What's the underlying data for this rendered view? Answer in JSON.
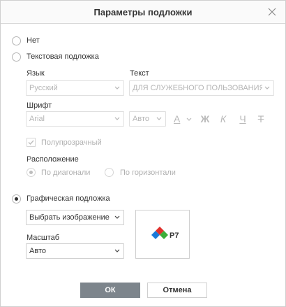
{
  "dialog": {
    "title": "Параметры подложки",
    "close_icon": "close-icon"
  },
  "options": {
    "none_label": "Нет",
    "text_watermark_label": "Текстовая подложка",
    "image_watermark_label": "Графическая подложка",
    "selected": "image"
  },
  "text_section": {
    "language_label": "Язык",
    "language_value": "Русский",
    "text_label": "Текст",
    "text_value": "ДЛЯ СЛУЖЕБНОГО ПОЛЬЗОВАНИЯ",
    "font_label": "Шрифт",
    "font_value": "Arial",
    "size_value": "Авто",
    "format_buttons": {
      "color": "A",
      "bold": "Ж",
      "italic": "К",
      "underline": "Ч",
      "strike": "Т"
    },
    "semitransparent_label": "Полупрозрачный",
    "semitransparent_checked": true,
    "layout_label": "Расположение",
    "layout_diagonal_label": "По диагонали",
    "layout_horizontal_label": "По горизонтали",
    "layout_selected": "diagonal"
  },
  "image_section": {
    "choose_image_label": "Выбрать изображение",
    "scale_label": "Масштаб",
    "scale_value": "Авто",
    "preview_text": "P7",
    "preview_colors": {
      "red": "#e0302c",
      "blue": "#1a7ad9",
      "green": "#3cae3a"
    }
  },
  "buttons": {
    "ok_label": "ОК",
    "cancel_label": "Отмена"
  },
  "colors": {
    "primary_button": "#7d858c",
    "border": "#cfcfcf",
    "disabled_text": "#b0b0b0"
  }
}
